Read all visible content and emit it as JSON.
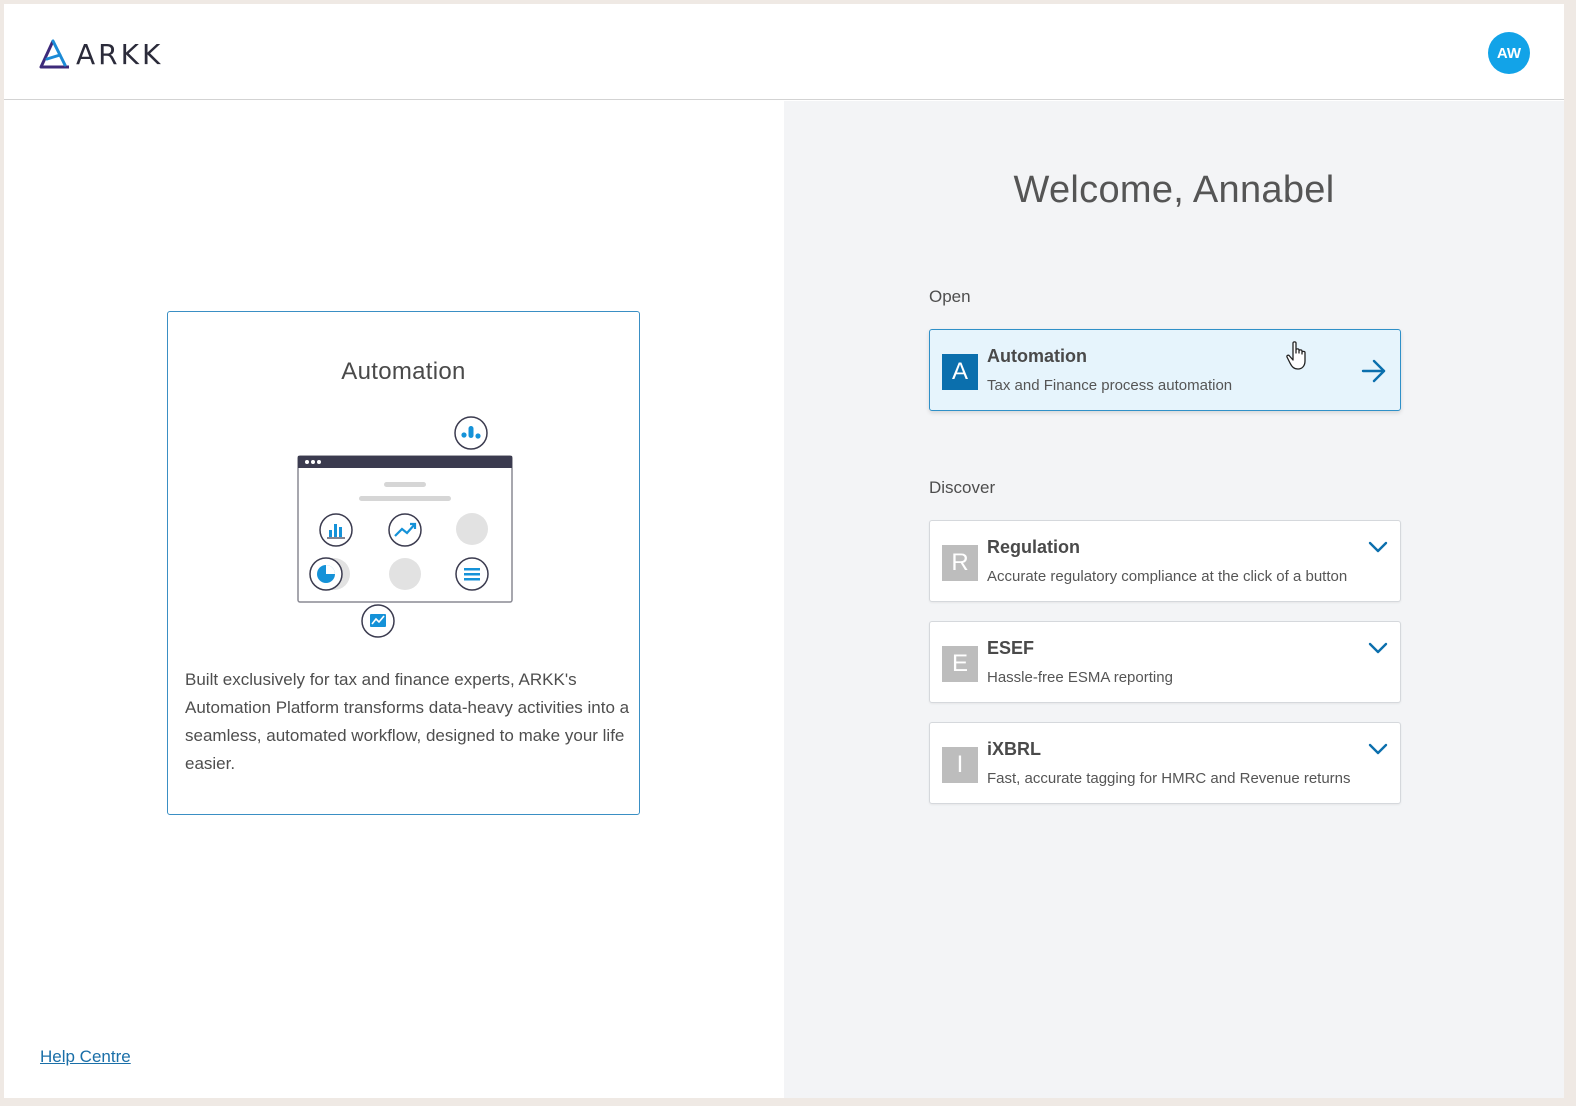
{
  "header": {
    "logo_text": "ARKK",
    "avatar_initials": "AW",
    "avatar_color": "#12a3e8"
  },
  "promo": {
    "title": "Automation",
    "description": "Built exclusively for tax and finance experts, ARKK's Automation Platform transforms data-heavy activities into a seamless, automated workflow, designed to make your life easier."
  },
  "footer": {
    "help_link": "Help Centre"
  },
  "main": {
    "welcome": "Welcome, Annabel",
    "open_label": "Open",
    "open_items": [
      {
        "badge": "A",
        "title": "Automation",
        "subtitle": "Tax and Finance process automation"
      }
    ],
    "discover_label": "Discover",
    "discover_items": [
      {
        "badge": "R",
        "title": "Regulation",
        "subtitle": "Accurate regulatory compliance at the click of a button"
      },
      {
        "badge": "E",
        "title": "ESEF",
        "subtitle": "Hassle-free ESMA reporting"
      },
      {
        "badge": "I",
        "title": "iXBRL",
        "subtitle": "Fast, accurate tagging for HMRC and Revenue returns"
      }
    ]
  },
  "colors": {
    "accent": "#0b6fad",
    "accent_light": "#e6f4fc",
    "link": "#1a6fa8",
    "icon_blue": "#1592d8"
  },
  "icons": [
    "arkk-logo-icon",
    "arrow-right-icon",
    "chevron-down-icon",
    "hand-cursor-icon"
  ]
}
